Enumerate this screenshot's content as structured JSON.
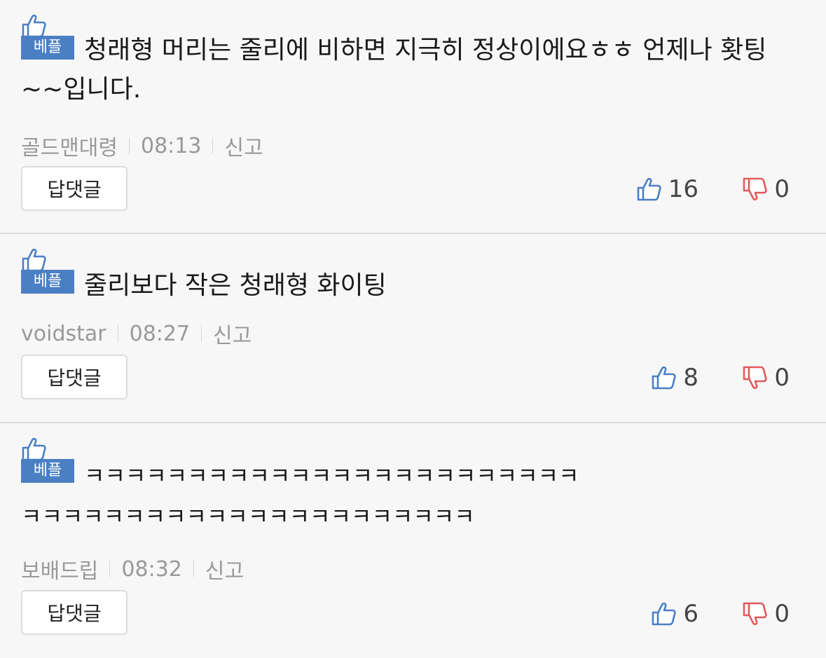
{
  "badge_label": "베플",
  "reply_label": "답댓글",
  "report_label": "신고",
  "colors": {
    "badge": "#4a7fc4",
    "like": "#4a7fc4",
    "dislike": "#e05a5a"
  },
  "comments": [
    {
      "text": "청래형 머리는 줄리에 비하면 지극히 정상이에요ㅎㅎ 언제나 홧팅~~입니다.",
      "author": "골드맨대령",
      "time": "08:13",
      "likes": "16",
      "dislikes": "0"
    },
    {
      "text": "줄리보다 작은 청래형 화이팅",
      "author": "voidstar",
      "time": "08:27",
      "likes": "8",
      "dislikes": "0"
    },
    {
      "text": "ㅋㅋㅋㅋㅋㅋㅋㅋㅋㅋㅋㅋㅋㅋㅋㅋㅋㅋㅋㅋㅋㅋㅋㅋ ㅋㅋㅋㅋㅋㅋㅋㅋㅋㅋㅋㅋㅋㅋㅋㅋㅋㅋㅋㅋㅋㅋ",
      "author": "보배드립",
      "time": "08:32",
      "likes": "6",
      "dislikes": "0"
    }
  ]
}
